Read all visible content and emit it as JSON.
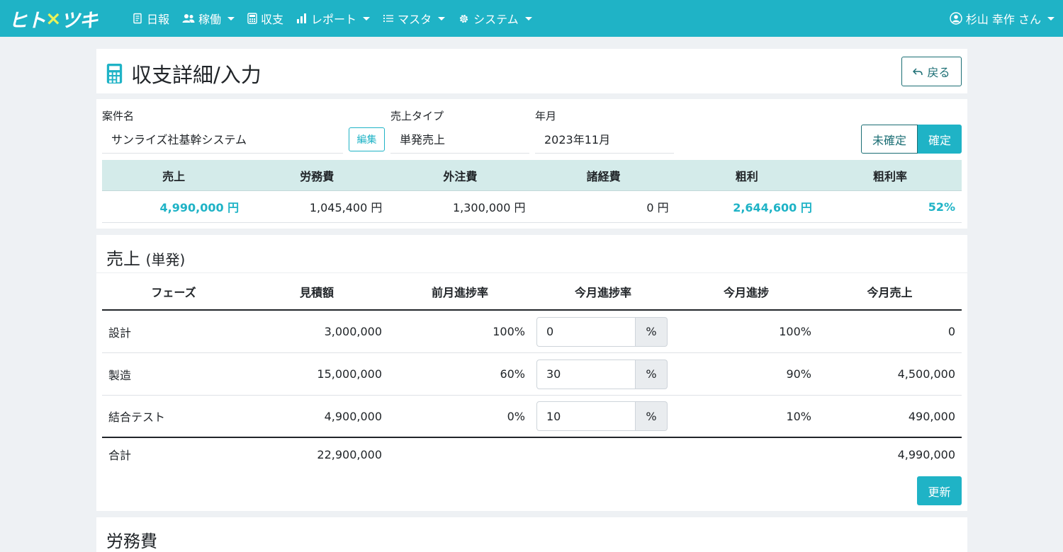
{
  "brand": {
    "prefix": "ヒト",
    "mark": "×",
    "suffix": "ツキ"
  },
  "nav": {
    "items": [
      {
        "label": "日報",
        "icon": "report-icon",
        "dropdown": false
      },
      {
        "label": "稼働",
        "icon": "users-icon",
        "dropdown": true
      },
      {
        "label": "収支",
        "icon": "calculator-icon",
        "dropdown": false
      },
      {
        "label": "レポート",
        "icon": "bar-chart-icon",
        "dropdown": true
      },
      {
        "label": "マスタ",
        "icon": "list-icon",
        "dropdown": true
      },
      {
        "label": "システム",
        "icon": "gear-icon",
        "dropdown": true
      }
    ],
    "user": "杉山 幸作 さん"
  },
  "page": {
    "title": "収支詳細/入力",
    "back_label": "戻る"
  },
  "summary": {
    "fields": {
      "project_label": "案件名",
      "project_value": "サンライズ社基幹システム",
      "edit_label": "編集",
      "sales_type_label": "売上タイプ",
      "sales_type_value": "単発売上",
      "month_label": "年月",
      "month_value": "2023年11月"
    },
    "status": {
      "unconfirmed": "未確定",
      "confirmed": "確定",
      "active": "confirmed"
    },
    "headers": [
      "売上",
      "労務費",
      "外注費",
      "諸経費",
      "粗利",
      "粗利率"
    ],
    "values": [
      "4,990,000 円",
      "1,045,400 円",
      "1,300,000 円",
      "0 円",
      "2,644,600 円",
      "52%"
    ]
  },
  "sales": {
    "title": "売上",
    "title_sub": "(単発)",
    "headers": [
      "フェーズ",
      "見積額",
      "前月進捗率",
      "今月進捗率",
      "今月進捗",
      "今月売上"
    ],
    "rows": [
      {
        "phase": "設計",
        "estimate": "3,000,000",
        "prev_rate": "100%",
        "this_rate": "0",
        "unit": "%",
        "progress": "100%",
        "sales": "0"
      },
      {
        "phase": "製造",
        "estimate": "15,000,000",
        "prev_rate": "60%",
        "this_rate": "30",
        "unit": "%",
        "progress": "90%",
        "sales": "4,500,000"
      },
      {
        "phase": "結合テスト",
        "estimate": "4,900,000",
        "prev_rate": "0%",
        "this_rate": "10",
        "unit": "%",
        "progress": "10%",
        "sales": "490,000"
      }
    ],
    "total": {
      "label": "合計",
      "estimate": "22,900,000",
      "sales": "4,990,000"
    },
    "update_label": "更新"
  },
  "labor": {
    "title": "労務費"
  },
  "colors": {
    "brand": "#1fb3c6",
    "accent_text": "#1fb3c6",
    "dark_teal": "#1b6e74",
    "summary_head_bg": "#d4ebea"
  }
}
